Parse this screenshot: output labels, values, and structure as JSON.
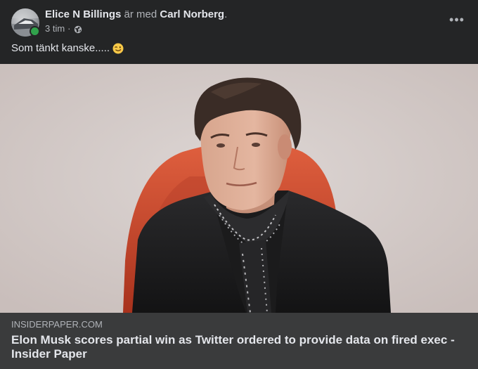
{
  "post": {
    "author_name": "Elice N Billings",
    "with_text": "är med",
    "tagged_name": "Carl Norberg",
    "period": ".",
    "timestamp": "3 tim",
    "separator": "·",
    "audience_icon": "globe-icon",
    "more_icon": "more-options-icon",
    "more_label": "•••",
    "message": "Som tänkt kanske.....",
    "emoji": "winking-smile-emoji"
  },
  "link": {
    "domain": "INSIDERPAPER.COM",
    "title": "Elon Musk scores partial win as Twitter ordered to provide data on fired exec - Insider Paper"
  },
  "colors": {
    "background": "#242526",
    "link_footer": "#3a3b3c",
    "primary_text": "#e4e6eb",
    "secondary_text": "#b0b3b8",
    "online": "#31a24c"
  }
}
